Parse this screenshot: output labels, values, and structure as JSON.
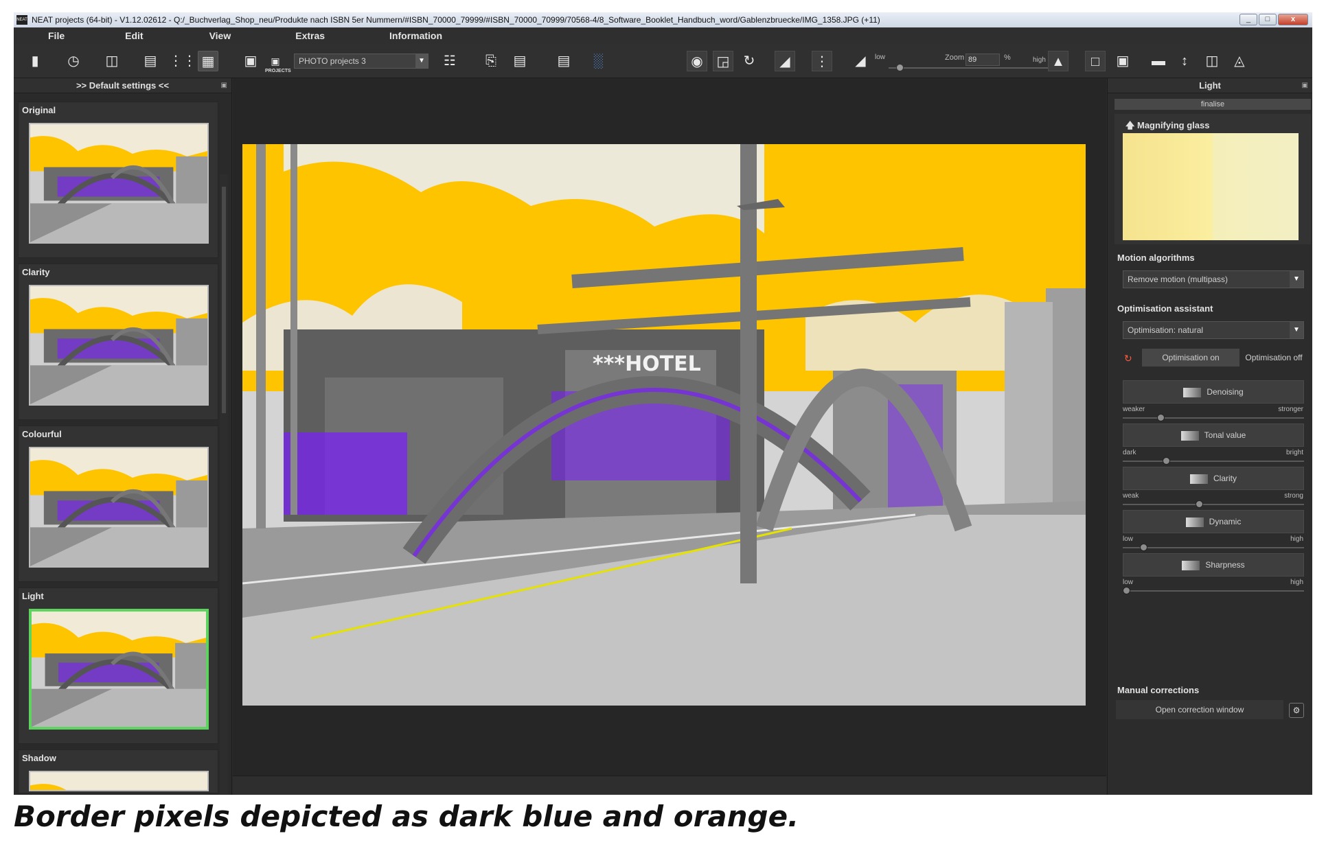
{
  "window": {
    "title": "NEAT projects (64-bit) - V1.12.02612 - Q:/_Buchverlag_Shop_neu/Produkte nach ISBN 5er Nummern/#ISBN_70000_79999/#ISBN_70000_70999/70568-4/8_Software_Booklet_Handbuch_word/Gablenzbruecke/IMG_1358.JPG (+11)",
    "app_icon_text": "NEAT",
    "minimize": "_",
    "maximize": "□",
    "close": "x"
  },
  "menu": [
    "File",
    "Edit",
    "View",
    "Extras",
    "Information"
  ],
  "toolbar": {
    "project_select": "PHOTO projects 3",
    "projects_caption": "PROJECTS",
    "low_label": "low",
    "high_label": "high",
    "zoom_label": "Zoom",
    "zoom_value": "89",
    "zoom_unit": "%",
    "zoom_fraction": 0.05
  },
  "left_panel": {
    "header": ">> Default settings <<",
    "presets": [
      {
        "label": "Original",
        "selected": false
      },
      {
        "label": "Clarity",
        "selected": false
      },
      {
        "label": "Colourful",
        "selected": false
      },
      {
        "label": "Light",
        "selected": true
      },
      {
        "label": "Shadow",
        "selected": false
      }
    ]
  },
  "photo": {
    "hotel_sign": "***HOTEL"
  },
  "right_panel": {
    "header": "Light",
    "finalise": "finalise",
    "magnifier_title": "Magnifying glass",
    "motion_title": "Motion algorithms",
    "motion_value": "Remove motion (multipass)",
    "opt_title": "Optimisation assistant",
    "opt_value": "Optimisation: natural",
    "opt_on": "Optimisation on",
    "opt_off": "Optimisation off",
    "tools": [
      {
        "label": "Denoising",
        "min": "weaker",
        "max": "stronger",
        "level": 0.2
      },
      {
        "label": "Tonal value",
        "min": "dark",
        "max": "bright",
        "level": 0.23
      },
      {
        "label": "Clarity",
        "min": "weak",
        "max": "strong",
        "level": 0.42
      },
      {
        "label": "Dynamic",
        "min": "low",
        "max": "high",
        "level": 0.1
      },
      {
        "label": "Sharpness",
        "min": "low",
        "max": "high",
        "level": 0.0
      }
    ],
    "manual_title": "Manual corrections",
    "open_correction": "Open correction window"
  },
  "caption": "Border pixels depicted as dark blue and orange.",
  "colors": {
    "sky": "#ffc400",
    "border_pixels": "#7a1cff",
    "selection": "#5fd35f",
    "panel": "#2b2b2b"
  }
}
